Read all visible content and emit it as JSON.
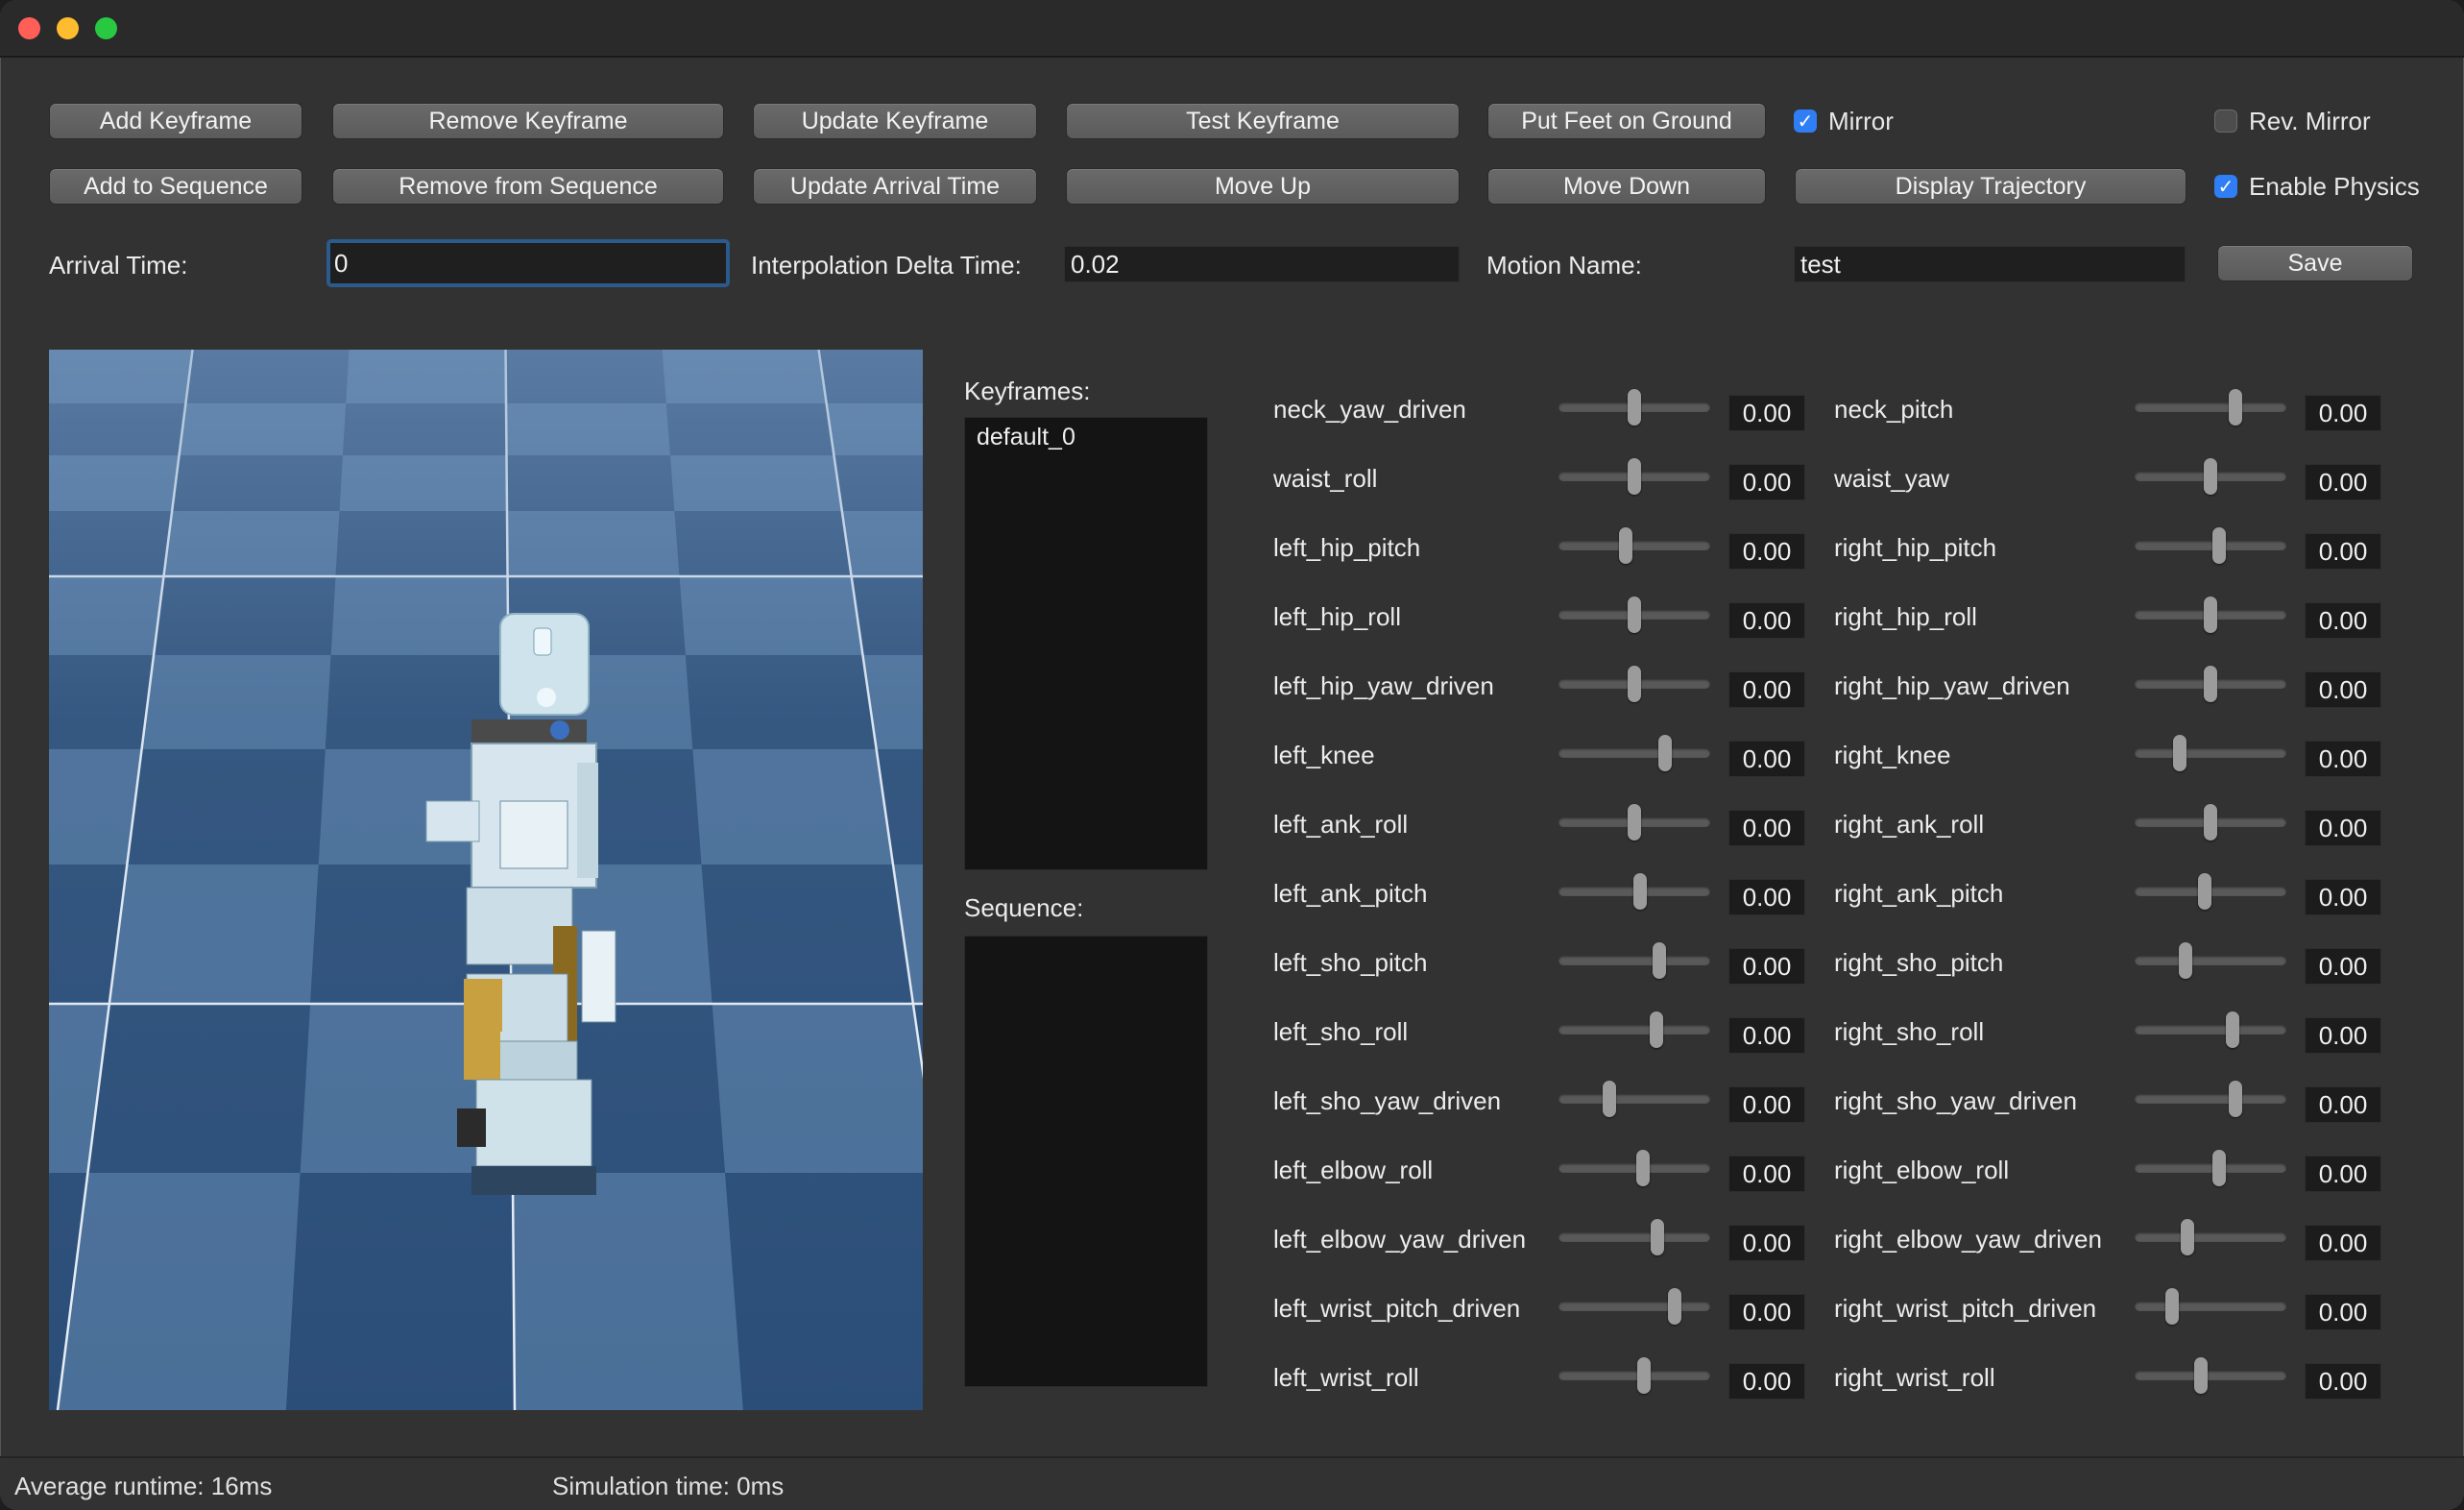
{
  "toolbar": {
    "row1": [
      "Add Keyframe",
      "Remove Keyframe",
      "Update Keyframe",
      "Test Keyframe",
      "Put Feet on Ground"
    ],
    "row2": [
      "Add to Sequence",
      "Remove from Sequence",
      "Update Arrival Time",
      "Move Up",
      "Move Down",
      "Display Trajectory"
    ],
    "save": "Save"
  },
  "checkboxes": {
    "mirror": {
      "label": "Mirror",
      "checked": true
    },
    "rev_mirror": {
      "label": "Rev. Mirror",
      "checked": false
    },
    "enable_physics": {
      "label": "Enable Physics",
      "checked": true
    }
  },
  "fields": {
    "arrival_time": {
      "label": "Arrival Time:",
      "value": "0"
    },
    "interp_dt": {
      "label": "Interpolation Delta Time:",
      "value": "0.02"
    },
    "motion_name": {
      "label": "Motion Name:",
      "value": "test"
    }
  },
  "keyframes": {
    "label": "Keyframes:",
    "items": [
      "default_0"
    ]
  },
  "sequence": {
    "label": "Sequence:",
    "items": []
  },
  "joints_left": [
    {
      "name": "neck_yaw_driven",
      "value": "0.00",
      "level": 0.5
    },
    {
      "name": "waist_roll",
      "value": "0.00",
      "level": 0.5
    },
    {
      "name": "left_hip_pitch",
      "value": "0.00",
      "level": 0.44
    },
    {
      "name": "left_hip_roll",
      "value": "0.00",
      "level": 0.5
    },
    {
      "name": "left_hip_yaw_driven",
      "value": "0.00",
      "level": 0.5
    },
    {
      "name": "left_knee",
      "value": "0.00",
      "level": 0.72
    },
    {
      "name": "left_ank_roll",
      "value": "0.00",
      "level": 0.5
    },
    {
      "name": "left_ank_pitch",
      "value": "0.00",
      "level": 0.54
    },
    {
      "name": "left_sho_pitch",
      "value": "0.00",
      "level": 0.68
    },
    {
      "name": "left_sho_roll",
      "value": "0.00",
      "level": 0.66
    },
    {
      "name": "left_sho_yaw_driven",
      "value": "0.00",
      "level": 0.32
    },
    {
      "name": "left_elbow_roll",
      "value": "0.00",
      "level": 0.56
    },
    {
      "name": "left_elbow_yaw_driven",
      "value": "0.00",
      "level": 0.67
    },
    {
      "name": "left_wrist_pitch_driven",
      "value": "0.00",
      "level": 0.79
    },
    {
      "name": "left_wrist_roll",
      "value": "0.00",
      "level": 0.57
    }
  ],
  "joints_right": [
    {
      "name": "neck_pitch",
      "value": "0.00",
      "level": 0.68
    },
    {
      "name": "waist_yaw",
      "value": "0.00",
      "level": 0.5
    },
    {
      "name": "right_hip_pitch",
      "value": "0.00",
      "level": 0.56
    },
    {
      "name": "right_hip_roll",
      "value": "0.00",
      "level": 0.5
    },
    {
      "name": "right_hip_yaw_driven",
      "value": "0.00",
      "level": 0.5
    },
    {
      "name": "right_knee",
      "value": "0.00",
      "level": 0.28
    },
    {
      "name": "right_ank_roll",
      "value": "0.00",
      "level": 0.5
    },
    {
      "name": "right_ank_pitch",
      "value": "0.00",
      "level": 0.46
    },
    {
      "name": "right_sho_pitch",
      "value": "0.00",
      "level": 0.32
    },
    {
      "name": "right_sho_roll",
      "value": "0.00",
      "level": 0.66
    },
    {
      "name": "right_sho_yaw_driven",
      "value": "0.00",
      "level": 0.68
    },
    {
      "name": "right_elbow_roll",
      "value": "0.00",
      "level": 0.56
    },
    {
      "name": "right_elbow_yaw_driven",
      "value": "0.00",
      "level": 0.33
    },
    {
      "name": "right_wrist_pitch_driven",
      "value": "0.00",
      "level": 0.22
    },
    {
      "name": "right_wrist_roll",
      "value": "0.00",
      "level": 0.43
    }
  ],
  "status": {
    "avg_runtime": "Average runtime: 16ms",
    "sim_time": "Simulation time: 0ms"
  },
  "colors": {
    "accent": "#2f7ef5",
    "floor_dark": "#2b4e78",
    "floor_light": "#4a6f98",
    "focus_ring": "#2b5a8c"
  }
}
